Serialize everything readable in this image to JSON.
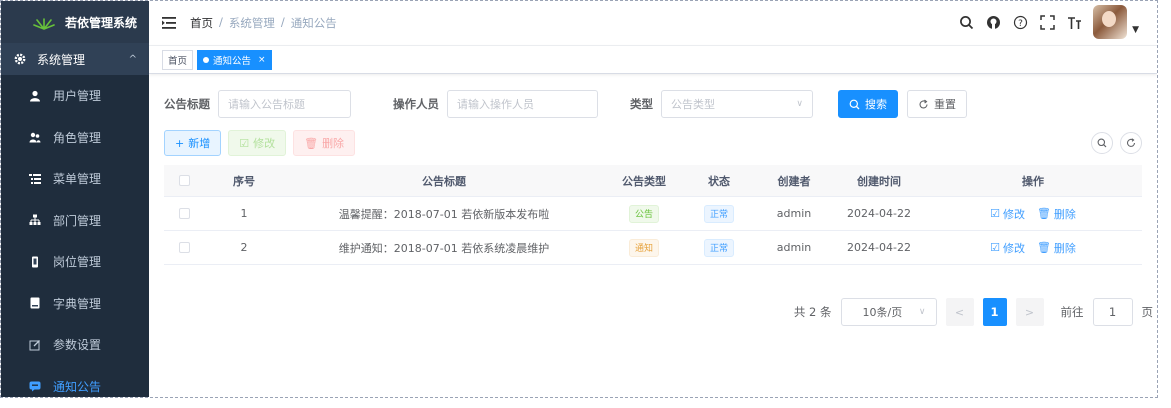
{
  "app": {
    "title": "若依管理系统"
  },
  "sidebar": {
    "section": {
      "label": "系统管理"
    },
    "items": [
      {
        "label": "用户管理",
        "icon": "user-icon"
      },
      {
        "label": "角色管理",
        "icon": "peoples-icon"
      },
      {
        "label": "菜单管理",
        "icon": "tree-table-icon"
      },
      {
        "label": "部门管理",
        "icon": "tree-icon"
      },
      {
        "label": "岗位管理",
        "icon": "post-icon"
      },
      {
        "label": "字典管理",
        "icon": "dict-icon"
      },
      {
        "label": "参数设置",
        "icon": "edit-icon"
      },
      {
        "label": "通知公告",
        "icon": "message-icon",
        "active": true
      }
    ]
  },
  "navbar": {
    "breadcrumb": {
      "home": "首页",
      "sep": "/",
      "level1": "系统管理",
      "level2": "通知公告"
    }
  },
  "tags": {
    "home": "首页",
    "current": "通知公告",
    "close": "×"
  },
  "search": {
    "title_label": "公告标题",
    "title_placeholder": "请输入公告标题",
    "operator_label": "操作人员",
    "operator_placeholder": "请输入操作人员",
    "type_label": "类型",
    "type_placeholder": "公告类型",
    "search_btn": "搜索",
    "reset_btn": "重置"
  },
  "toolbar": {
    "add": "新增",
    "edit": "修改",
    "delete": "删除"
  },
  "table": {
    "headers": [
      "序号",
      "公告标题",
      "公告类型",
      "状态",
      "创建者",
      "创建时间",
      "操作"
    ],
    "rows": [
      {
        "index": "1",
        "title": "温馨提醒：2018-07-01 若依新版本发布啦",
        "type": "公告",
        "status": "正常",
        "creator": "admin",
        "created": "2024-04-22",
        "edit": "修改",
        "delete": "删除"
      },
      {
        "index": "2",
        "title": "维护通知：2018-07-01 若依系统凌晨维护",
        "type": "通知",
        "status": "正常",
        "creator": "admin",
        "created": "2024-04-22",
        "edit": "修改",
        "delete": "删除"
      }
    ]
  },
  "pagination": {
    "total": "共 2 条",
    "page_size": "10条/页",
    "current": "1",
    "goto_label": "前往",
    "goto_value": "1",
    "page_unit": "页"
  },
  "colors": {
    "sidebar_bg": "#304156",
    "primary": "#1890ff",
    "active_menu": "#409eff"
  }
}
